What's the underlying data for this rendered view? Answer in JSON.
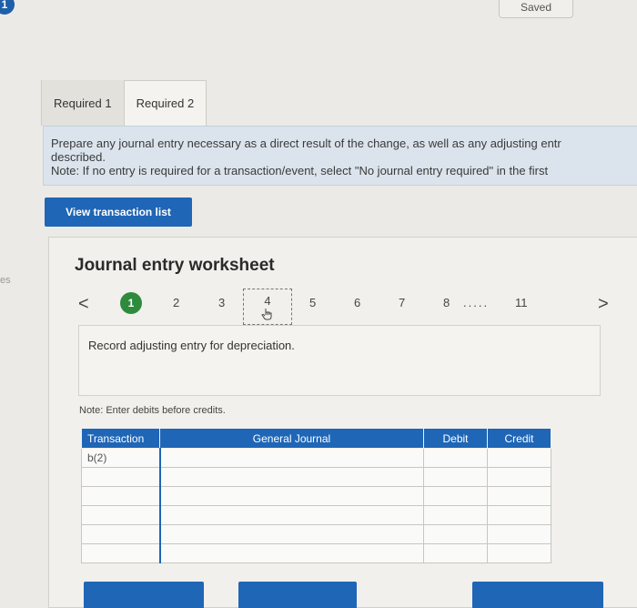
{
  "header": {
    "step_badge": "1",
    "saved_label": "Saved",
    "edge_text": "es"
  },
  "tabs": [
    {
      "label": "Required 1"
    },
    {
      "label": "Required 2"
    }
  ],
  "instructions": {
    "line1": "Prepare any journal entry necessary as a direct result of the change, as well as any adjusting entr",
    "line2": "described.",
    "line3": "Note: If no entry is required for a transaction/event, select \"No journal entry required\" in the first"
  },
  "view_transaction_label": "View transaction list",
  "worksheet": {
    "title": "Journal entry worksheet",
    "pager": {
      "prev": "<",
      "next": ">",
      "pages": [
        "1",
        "2",
        "3",
        "4",
        "5",
        "6",
        "7",
        "8",
        "11"
      ],
      "ellipsis": ".....",
      "active_page": "1",
      "current_page": "4"
    },
    "entry_description": "Record adjusting entry for depreciation.",
    "note": "Note: Enter debits before credits.",
    "table": {
      "headers": [
        "Transaction",
        "General Journal",
        "Debit",
        "Credit"
      ],
      "rows": [
        [
          "b(2)",
          "",
          "",
          ""
        ],
        [
          "",
          "",
          "",
          ""
        ],
        [
          "",
          "",
          "",
          ""
        ],
        [
          "",
          "",
          "",
          ""
        ],
        [
          "",
          "",
          "",
          ""
        ],
        [
          "",
          "",
          "",
          ""
        ]
      ]
    }
  },
  "colors": {
    "accent": "#1f66b6",
    "active_page": "#2e8b3d",
    "instruction_bg": "#dbe4ec"
  },
  "icons": {
    "pointer": "hand-pointer-icon"
  }
}
